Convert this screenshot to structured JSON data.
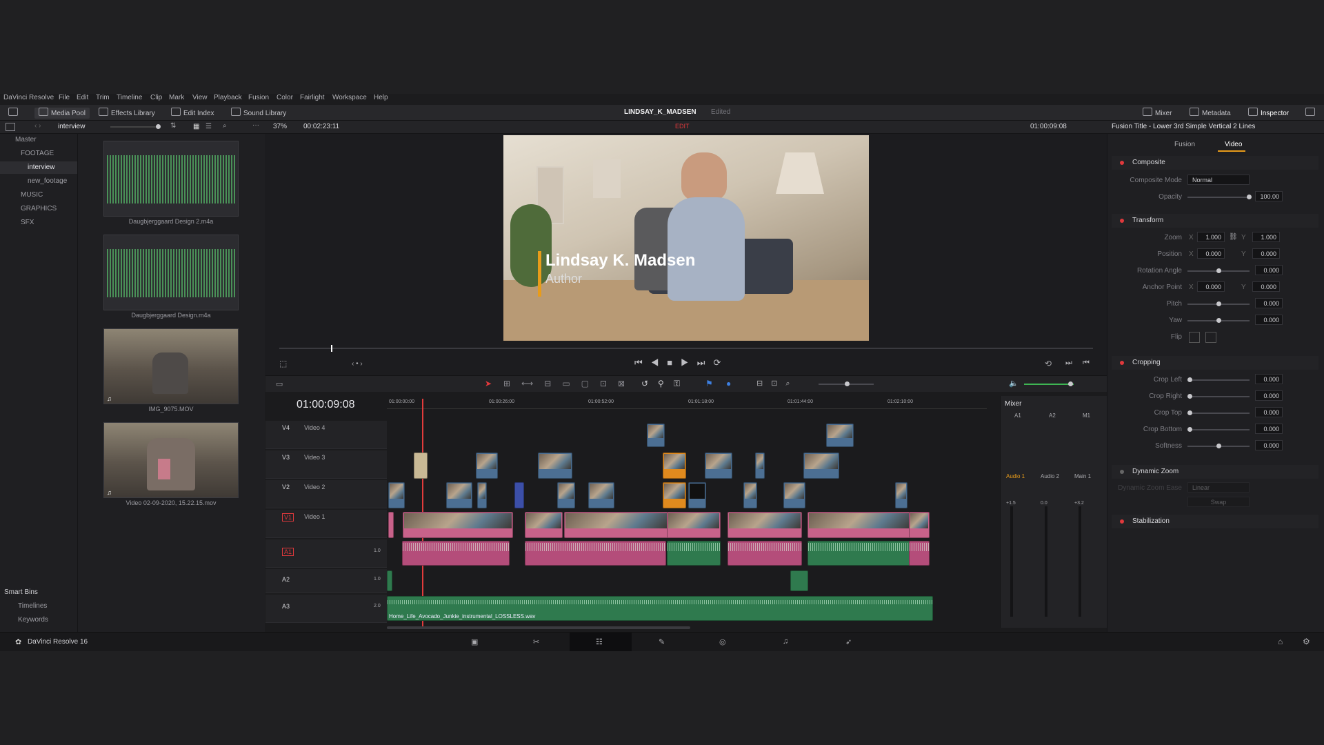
{
  "menu": [
    "DaVinci Resolve",
    "File",
    "Edit",
    "Trim",
    "Timeline",
    "Clip",
    "Mark",
    "View",
    "Playback",
    "Fusion",
    "Color",
    "Fairlight",
    "Workspace",
    "Help"
  ],
  "toolbar": {
    "media_pool": "Media Pool",
    "effects_library": "Effects Library",
    "edit_index": "Edit Index",
    "sound_library": "Sound Library",
    "project_title": "LINDSAY_K_MADSEN",
    "project_status": "Edited",
    "mixer": "Mixer",
    "metadata": "Metadata",
    "inspector": "Inspector"
  },
  "subbar": {
    "bin_name": "interview",
    "zoom": "37%",
    "source_tc": "00:02:23:11",
    "mode": "EDIT",
    "record_tc": "01:00:09:08",
    "inspector_title": "Fusion Title - Lower 3rd Simple Vertical 2 Lines"
  },
  "bins": {
    "master": "Master",
    "footage": "FOOTAGE",
    "interview": "interview",
    "new_footage": "new_footage",
    "music": "MUSIC",
    "graphics": "GRAPHICS",
    "sfx": "SFX",
    "smart_bins": "Smart Bins",
    "timelines": "Timelines",
    "keywords": "Keywords"
  },
  "media": [
    {
      "name": "Daugbjerggaard Design 2.m4a",
      "kind": "audio"
    },
    {
      "name": "Daugbjerggaard Design.m4a",
      "kind": "audio"
    },
    {
      "name": "IMG_9075.MOV",
      "kind": "video"
    },
    {
      "name": "Video 02-09-2020, 15.22.15.mov",
      "kind": "video"
    }
  ],
  "viewer": {
    "lower_third_name": "Lindsay K. Madsen",
    "lower_third_title": "Author"
  },
  "timeline": {
    "timecode": "01:00:09:08",
    "ruler": [
      "01:00:00:00",
      "01:00:26:00",
      "01:00:52:00",
      "01:01:18:00",
      "01:01:44:00",
      "01:02:10:00"
    ],
    "tracks": [
      {
        "id": "V4",
        "name": "Video 4"
      },
      {
        "id": "V3",
        "name": "Video 3"
      },
      {
        "id": "V2",
        "name": "Video 2"
      },
      {
        "id": "V1",
        "name": "Video 1"
      },
      {
        "id": "A1",
        "vol": "1.0"
      },
      {
        "id": "A2",
        "vol": "1.0"
      },
      {
        "id": "A3",
        "vol": "2.0"
      }
    ],
    "music_clip": "Home_Life_Avocado_Junkie_instrumental_LOSSLESS.wav"
  },
  "mixer": {
    "title": "Mixer",
    "channels": [
      "A1",
      "A2",
      "M1"
    ],
    "channel_names": [
      "Audio 1",
      "Audio 2",
      "Main 1"
    ],
    "gains": [
      "+1.5",
      "0.0",
      "+3.2"
    ]
  },
  "inspector": {
    "tab_fusion": "Fusion",
    "tab_video": "Video",
    "composite": "Composite",
    "composite_mode_label": "Composite Mode",
    "composite_mode": "Normal",
    "opacity_label": "Opacity",
    "opacity": "100.00",
    "transform": "Transform",
    "zoom_label": "Zoom",
    "zoom_x": "1.000",
    "zoom_y": "1.000",
    "position_label": "Position",
    "pos_x": "0.000",
    "pos_y": "0.000",
    "rotation_label": "Rotation Angle",
    "rotation": "0.000",
    "anchor_label": "Anchor Point",
    "anchor_x": "0.000",
    "anchor_y": "0.000",
    "pitch_label": "Pitch",
    "pitch": "0.000",
    "yaw_label": "Yaw",
    "yaw": "0.000",
    "flip_label": "Flip",
    "cropping": "Cropping",
    "crop_left_label": "Crop Left",
    "crop_left": "0.000",
    "crop_right_label": "Crop Right",
    "crop_right": "0.000",
    "crop_top_label": "Crop Top",
    "crop_top": "0.000",
    "crop_bottom_label": "Crop Bottom",
    "crop_bottom": "0.000",
    "softness_label": "Softness",
    "softness": "0.000",
    "dynamic_zoom": "Dynamic Zoom",
    "dz_ease_label": "Dynamic Zoom Ease",
    "dz_ease": "Linear",
    "swap": "Swap",
    "stabilization": "Stabilization",
    "x": "X",
    "y": "Y"
  },
  "footer": {
    "app_version": "DaVinci Resolve 16"
  }
}
